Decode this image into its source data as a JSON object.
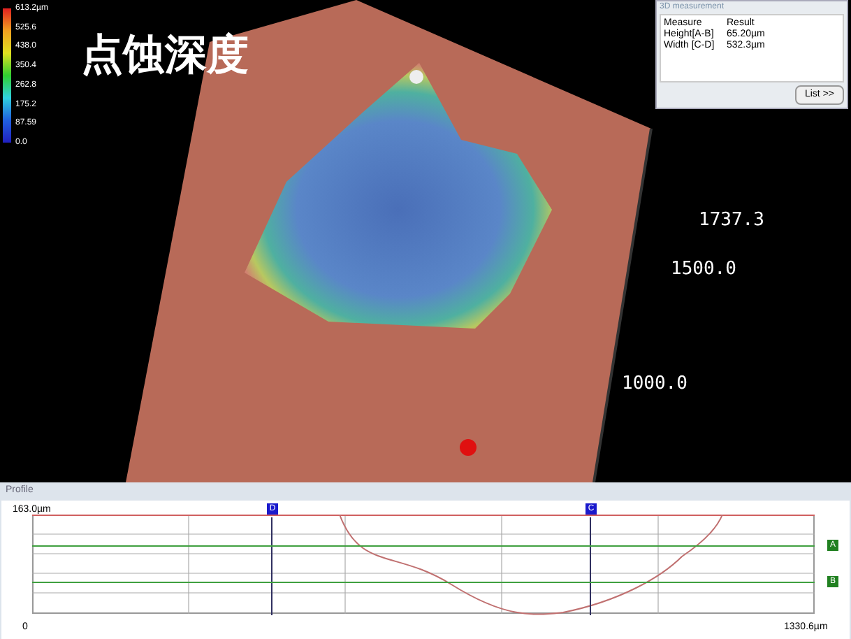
{
  "title": "点蚀深度",
  "legend": {
    "labels": [
      "613.2µm",
      "525.6",
      "438.0",
      "350.4",
      "262.8",
      "175.2",
      "87.59",
      "0.0"
    ]
  },
  "axis_labels": [
    "1737.3",
    "1500.0",
    "1000.0"
  ],
  "measurement_panel": {
    "title": "3D measurement",
    "columns": [
      "Measure",
      "Result"
    ],
    "rows": [
      [
        "Height[A-B]",
        "65.20µm"
      ],
      [
        "Width [C-D]",
        "532.3µm"
      ]
    ],
    "button": "List >>"
  },
  "profile": {
    "title": "Profile",
    "y_top": "163.0µm",
    "x_start": "0",
    "x_end": "1330.6µm",
    "markers": [
      {
        "label": "D",
        "kind": "vertical"
      },
      {
        "label": "C",
        "kind": "vertical"
      },
      {
        "label": "A",
        "kind": "horizontal"
      },
      {
        "label": "B",
        "kind": "horizontal"
      }
    ]
  }
}
